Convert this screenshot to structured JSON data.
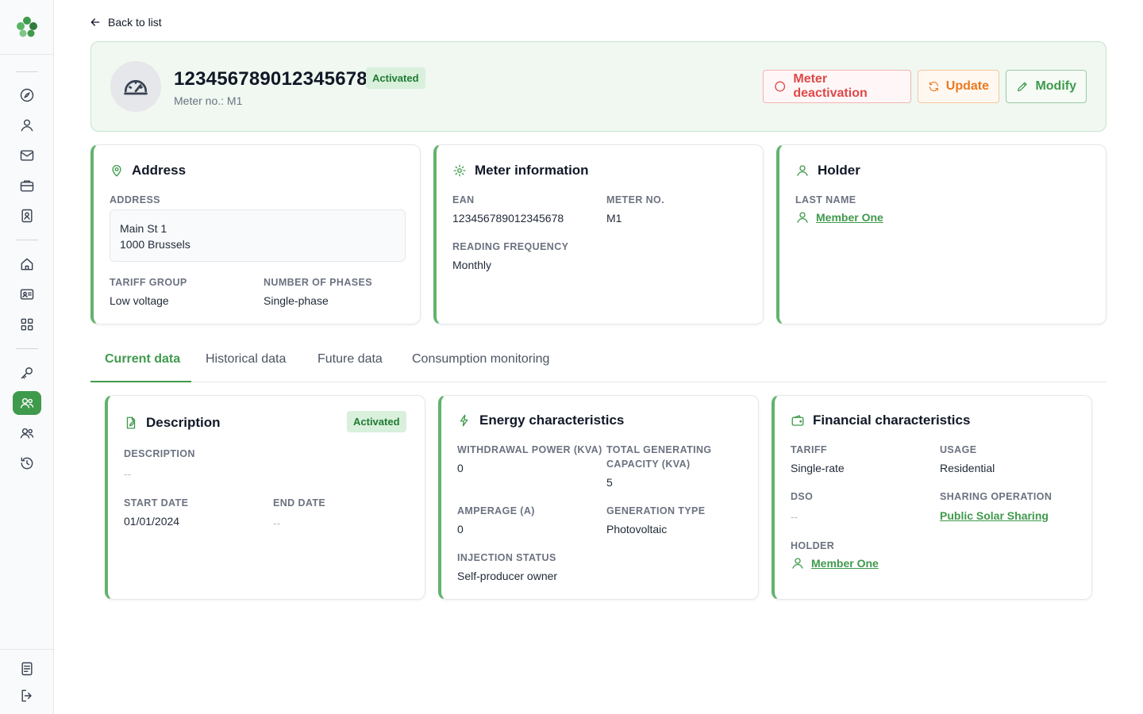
{
  "nav": {
    "back_label": "Back to list"
  },
  "header": {
    "title": "123456789012345678",
    "status": "Activated",
    "subtitle": "Meter no.: M1",
    "actions": {
      "deactivate": "Meter deactivation",
      "update": "Update",
      "modify": "Modify"
    }
  },
  "address_card": {
    "title": "Address",
    "address_label": "ADDRESS",
    "address_line1": "Main St 1",
    "address_line2": "1000 Brussels",
    "tariff_group_label": "TARIFF GROUP",
    "tariff_group": "Low voltage",
    "phases_label": "NUMBER OF PHASES",
    "phases": "Single-phase"
  },
  "meter_card": {
    "title": "Meter information",
    "ean_label": "EAN",
    "ean": "123456789012345678",
    "meter_no_label": "METER NO.",
    "meter_no": "M1",
    "reading_freq_label": "READING FREQUENCY",
    "reading_freq": "Monthly"
  },
  "holder_card": {
    "title": "Holder",
    "last_name_label": "LAST NAME",
    "last_name": "Member One"
  },
  "tabs": [
    {
      "label": "Current data"
    },
    {
      "label": "Historical data"
    },
    {
      "label": "Future data"
    },
    {
      "label": "Consumption monitoring"
    }
  ],
  "description_card": {
    "title": "Description",
    "status": "Activated",
    "description_label": "DESCRIPTION",
    "description": "--",
    "start_label": "START DATE",
    "start": "01/01/2024",
    "end_label": "END DATE",
    "end": "--"
  },
  "energy_card": {
    "title": "Energy characteristics",
    "withdrawal_label": "WITHDRAWAL POWER (KVA)",
    "withdrawal": "0",
    "generating_label_1": "TOTAL GENERATING",
    "generating_label_2": "CAPACITY (KVA)",
    "generating": "5",
    "amperage_label": "AMPERAGE (A)",
    "amperage": "0",
    "generation_type_label": "GENERATION TYPE",
    "generation_type": "Photovoltaic",
    "injection_label": "INJECTION STATUS",
    "injection": "Self-producer owner"
  },
  "financial_card": {
    "title": "Financial characteristics",
    "tariff_label": "TARIFF",
    "tariff": "Single-rate",
    "usage_label": "USAGE",
    "usage": "Residential",
    "dso_label": "DSO",
    "dso": "--",
    "sharing_label": "SHARING OPERATION",
    "sharing": "Public Solar Sharing",
    "holder_label": "HOLDER",
    "holder": "Member One"
  },
  "colors": {
    "accent": "#3f9a4c",
    "danger": "#e04848",
    "warning": "#ea7a20"
  },
  "icons": {
    "sidebar": [
      "compass-icon",
      "user-icon",
      "mail-icon",
      "briefcase-icon",
      "contact-card-icon",
      "home-icon",
      "id-card-icon",
      "grid-icon",
      "key-icon",
      "users-icon",
      "group-icon",
      "history-icon",
      "document-icon",
      "logout-icon"
    ]
  }
}
